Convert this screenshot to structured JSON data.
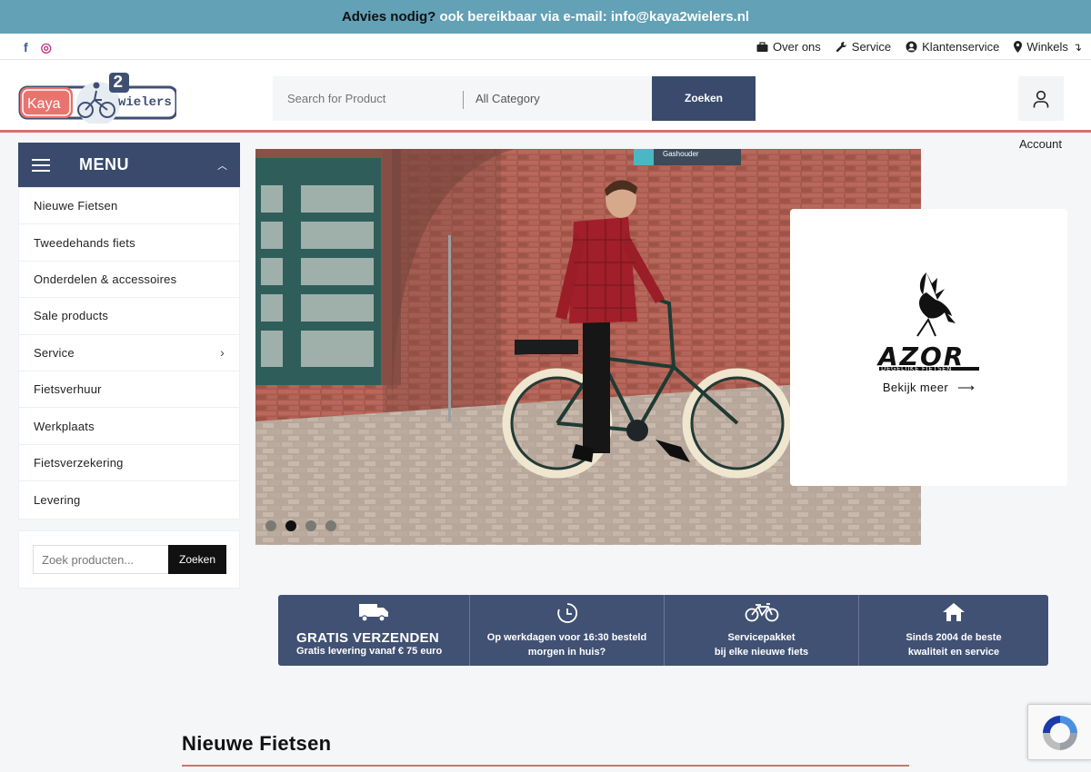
{
  "announcement": {
    "prefix": "Advies nodig?",
    "text": "ook bereikbaar via e-mail: info@kaya2wielers.nl"
  },
  "social": {
    "facebook_glyph": "f",
    "instagram_glyph": "◎"
  },
  "top_links": [
    {
      "label": "Over ons",
      "icon": "briefcase-icon"
    },
    {
      "label": "Service",
      "icon": "wrench-icon"
    },
    {
      "label": "Klantenservice",
      "icon": "user-circle-icon"
    },
    {
      "label": "Winkels",
      "icon": "map-marker-icon"
    }
  ],
  "logo": {
    "text_left": "Kaya",
    "text_digit": "2",
    "text_right": "wielers"
  },
  "search": {
    "placeholder": "Search for Product",
    "category": "All Category",
    "button": "Zoeken"
  },
  "account": {
    "label": "Account"
  },
  "menu": {
    "title": "MENU",
    "items": [
      {
        "label": "Nieuwe Fietsen"
      },
      {
        "label": "Tweedehands fiets"
      },
      {
        "label": "Onderdelen & accessoires"
      },
      {
        "label": "Sale products"
      },
      {
        "label": "Service",
        "has_submenu": true
      },
      {
        "label": "Fietsverhuur"
      },
      {
        "label": "Werkplaats"
      },
      {
        "label": "Fietsverzekering"
      },
      {
        "label": "Levering"
      }
    ]
  },
  "sidebar_search": {
    "placeholder": "Zoek producten...",
    "button": "Zoeken"
  },
  "hero": {
    "sign": "Gashouder",
    "active_slide": 2,
    "slide_count": 4
  },
  "brand_card": {
    "brand": "AZOR",
    "tagline": "DEGELIJKE FIETSEN",
    "link": "Bekijk meer"
  },
  "usp": [
    {
      "icon": "truck-icon",
      "title": "GRATIS VERZENDEN",
      "subtitle": "Gratis levering vanaf € 75 euro"
    },
    {
      "icon": "clock-icon",
      "line1": "Op werkdagen voor 16:30 besteld",
      "line2": "morgen in huis?"
    },
    {
      "icon": "bicycle-icon",
      "line1": "Servicepakket",
      "line2": "bij elke nieuwe fiets"
    },
    {
      "icon": "home-icon",
      "line1": "Sinds 2004 de beste",
      "line2": "kwaliteit en service"
    }
  ],
  "section": {
    "title": "Nieuwe Fietsen"
  },
  "colors": {
    "announce_bg": "#63a1b6",
    "primary_navy": "#394a6c",
    "accent_red": "#d9706c"
  }
}
